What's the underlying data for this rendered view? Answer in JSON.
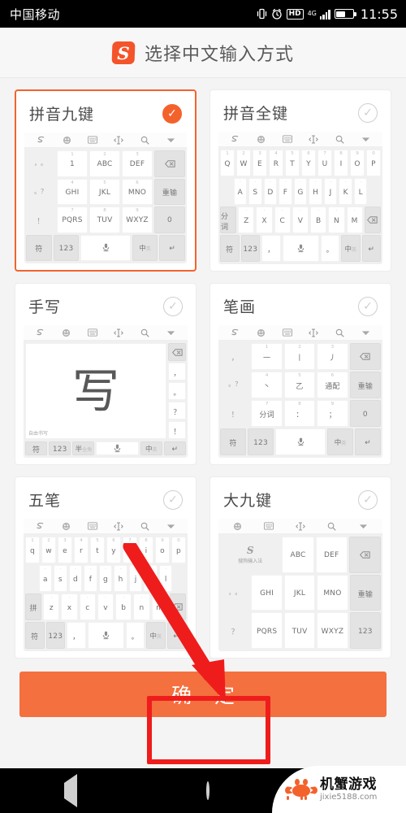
{
  "status_bar": {
    "carrier": "中国移动",
    "vibrate_icon": "vibrate-icon",
    "alarm_icon": "alarm-clock-icon",
    "hd_label": "HD",
    "network_label": "4G",
    "time": "11:55"
  },
  "header": {
    "logo": "sogou-logo",
    "logo_letter": "S",
    "title": "选择中文输入方式"
  },
  "toolbar_icons": [
    "sogou-icon",
    "emoji-icon",
    "keyboard-icon",
    "cursor-move-icon",
    "search-icon",
    "chevron-down-icon"
  ],
  "cards": [
    {
      "id": "pinyin-nine-key",
      "title": "拼音九键",
      "selected": true,
      "check_icon": "check-circle-filled-icon",
      "keyboard_type": "nine-key",
      "rows": [
        [
          {
            "t": "，\n。",
            "k": "flat"
          },
          {
            "t": "1",
            "s": "1"
          },
          {
            "t": "ABC",
            "s": "2"
          },
          {
            "t": "DEF",
            "s": "3"
          },
          {
            "t": "⌫",
            "k": "fn"
          }
        ],
        [
          {
            "t": "。\n？",
            "k": "flat"
          },
          {
            "t": "GHI",
            "s": "4"
          },
          {
            "t": "JKL",
            "s": "5"
          },
          {
            "t": "MNO",
            "s": "6"
          },
          {
            "t": "重输",
            "k": "fn"
          }
        ],
        [
          {
            "t": "！",
            "k": "flat"
          },
          {
            "t": "PQRS",
            "s": "7"
          },
          {
            "t": "TUV",
            "s": "8"
          },
          {
            "t": "WXYZ",
            "s": "9"
          },
          {
            "t": "0",
            "k": "fn"
          }
        ],
        [
          {
            "t": "符",
            "k": "fn"
          },
          {
            "t": "123",
            "k": "fn"
          },
          {
            "t": "🎙",
            "w": 2
          },
          {
            "t": "中英",
            "k": "fn"
          },
          {
            "t": "↵",
            "k": "fn"
          }
        ]
      ]
    },
    {
      "id": "pinyin-full-key",
      "title": "拼音全键",
      "selected": false,
      "check_icon": "check-circle-outline-icon",
      "keyboard_type": "qwerty-upper",
      "row1": [
        "Q",
        "W",
        "E",
        "R",
        "T",
        "Y",
        "U",
        "I",
        "O",
        "P"
      ],
      "row1_nums": [
        "1",
        "2",
        "3",
        "4",
        "5",
        "6",
        "7",
        "8",
        "9",
        "0"
      ],
      "row2": [
        "A",
        "S",
        "D",
        "F",
        "G",
        "H",
        "J",
        "K",
        "L"
      ],
      "row3_fn": "分词",
      "row3": [
        "Z",
        "X",
        "C",
        "V",
        "B",
        "N",
        "M"
      ],
      "row3_end": "⌫",
      "row4": [
        "符",
        "123",
        "，",
        "🎙",
        "。",
        "中英",
        "↵"
      ]
    },
    {
      "id": "handwriting",
      "title": "手写",
      "selected": false,
      "check_icon": "check-circle-outline-icon",
      "keyboard_type": "handwriting",
      "pad_char": "写",
      "pad_label": "自由书写",
      "side_keys": [
        "⌫",
        "，",
        "。",
        "？",
        "！"
      ],
      "bottom_keys": [
        "符",
        "123",
        "半全角",
        "🎙",
        "中英",
        "↵"
      ]
    },
    {
      "id": "stroke",
      "title": "笔画",
      "selected": false,
      "check_icon": "check-circle-outline-icon",
      "keyboard_type": "nine-key",
      "rows": [
        [
          {
            "t": "，",
            "k": "flat"
          },
          {
            "t": "一",
            "s": "1"
          },
          {
            "t": "丨",
            "s": "2"
          },
          {
            "t": "丿",
            "s": "3"
          },
          {
            "t": "⌫",
            "k": "fn"
          }
        ],
        [
          {
            "t": "。\n？",
            "k": "flat"
          },
          {
            "t": "丶",
            "s": "4"
          },
          {
            "t": "乙",
            "s": "5"
          },
          {
            "t": "通配",
            "s": "6"
          },
          {
            "t": "重输",
            "k": "fn"
          }
        ],
        [
          {
            "t": "！",
            "k": "flat"
          },
          {
            "t": "分词",
            "s": "7"
          },
          {
            "t": "：",
            "s": "8"
          },
          {
            "t": "；",
            "s": "9"
          },
          {
            "t": "0",
            "k": "fn"
          }
        ],
        [
          {
            "t": "符",
            "k": "fn"
          },
          {
            "t": "123",
            "k": "fn"
          },
          {
            "t": "🎙",
            "w": 2
          },
          {
            "t": "中英",
            "k": "fn"
          },
          {
            "t": "↵",
            "k": "fn"
          }
        ]
      ]
    },
    {
      "id": "wubi",
      "title": "五笔",
      "selected": false,
      "check_icon": "check-circle-outline-icon",
      "keyboard_type": "qwerty-lower",
      "row1": [
        "q",
        "w",
        "e",
        "r",
        "t",
        "y",
        "u",
        "i",
        "o",
        "p"
      ],
      "row1_nums": [
        "1",
        "2",
        "3",
        "4",
        "5",
        "6",
        "7",
        "8",
        "9",
        "0"
      ],
      "row2": [
        "a",
        "s",
        "d",
        "f",
        "g",
        "h",
        "j",
        "k",
        "l"
      ],
      "row3_fn": "拼",
      "row3": [
        "z",
        "x",
        "c",
        "v",
        "b",
        "n",
        "m"
      ],
      "row3_end": "⌫",
      "row4": [
        "符",
        "123",
        "，",
        "🎙",
        "。",
        "中英",
        "↵"
      ]
    },
    {
      "id": "big-nine-key",
      "title": "大九键",
      "selected": false,
      "check_icon": "check-circle-outline-icon",
      "keyboard_type": "big-nine",
      "brand_letter": "S",
      "brand_name": "搜狗输入法",
      "rows": [
        [
          {
            "t": "ABC"
          },
          {
            "t": "DEF"
          },
          {
            "t": "⌫",
            "k": "fn"
          }
        ],
        [
          {
            "t": "，\n。",
            "k": "flat"
          },
          {
            "t": "GHI"
          },
          {
            "t": "JKL"
          },
          {
            "t": "MNO"
          },
          {
            "t": "重输",
            "k": "fn"
          }
        ],
        [
          {
            "t": "？",
            "k": "flat"
          },
          {
            "t": "PQRS"
          },
          {
            "t": "TUV"
          },
          {
            "t": "WXYZ"
          },
          {
            "t": "123",
            "k": "fn"
          }
        ]
      ]
    }
  ],
  "confirm": {
    "label": "确 定",
    "color": "#f4703f"
  },
  "annotations": {
    "highlight_color": "#ef1c1c",
    "arrow": "red-arrow-pointing-to-confirm",
    "rect": "red-rectangle-around-confirm"
  },
  "nav_bar": {
    "back_icon": "back-triangle-icon",
    "home_icon": "home-circle-icon",
    "recents_icon": "recents-square-icon"
  },
  "watermark": {
    "logo": "crab-logo-icon",
    "title": "机蟹游戏",
    "url": "jixie5188.com"
  }
}
